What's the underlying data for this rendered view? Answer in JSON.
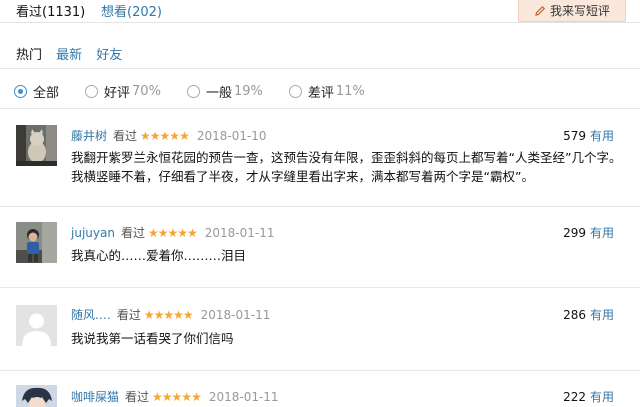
{
  "tabs": {
    "watched": "看过(1131)",
    "want": "想看(202)"
  },
  "write_button": "我来写短评",
  "sort": {
    "hot": "热门",
    "latest": "最新",
    "friends": "好友"
  },
  "filters": [
    {
      "label": "全部",
      "pct": "",
      "checked": true
    },
    {
      "label": "好评",
      "pct": "70%",
      "checked": false
    },
    {
      "label": "一般",
      "pct": "19%",
      "checked": false
    },
    {
      "label": "差评",
      "pct": "11%",
      "checked": false
    }
  ],
  "useful_label": "有用",
  "stars_text": "★★★★★",
  "comments": [
    {
      "user": "藤井树",
      "status": "看过",
      "rating": 5,
      "date": "2018-01-10",
      "votes": "579",
      "text": "我翻开紫罗兰永恒花园的预告一查，这预告没有年限，歪歪斜斜的每页上都写着“人类圣经”几个字。我横竖睡不着，仔细看了半夜，才从字缝里看出字来，满本都写着两个字是“霸权”。",
      "avatar": "cat-photo"
    },
    {
      "user": "jujuyan",
      "status": "看过",
      "rating": 5,
      "date": "2018-01-11",
      "votes": "299",
      "text": "我真心的……爱着你………泪目",
      "avatar": "child-photo"
    },
    {
      "user": "随风.…",
      "status": "看过",
      "rating": 5,
      "date": "2018-01-11",
      "votes": "286",
      "text": "我说我第一话看哭了你们信吗",
      "avatar": "default-avatar"
    },
    {
      "user": "咖啡屎猫",
      "status": "看过",
      "rating": 5,
      "date": "2018-01-11",
      "votes": "222",
      "text": "",
      "avatar": "character-photo"
    }
  ]
}
